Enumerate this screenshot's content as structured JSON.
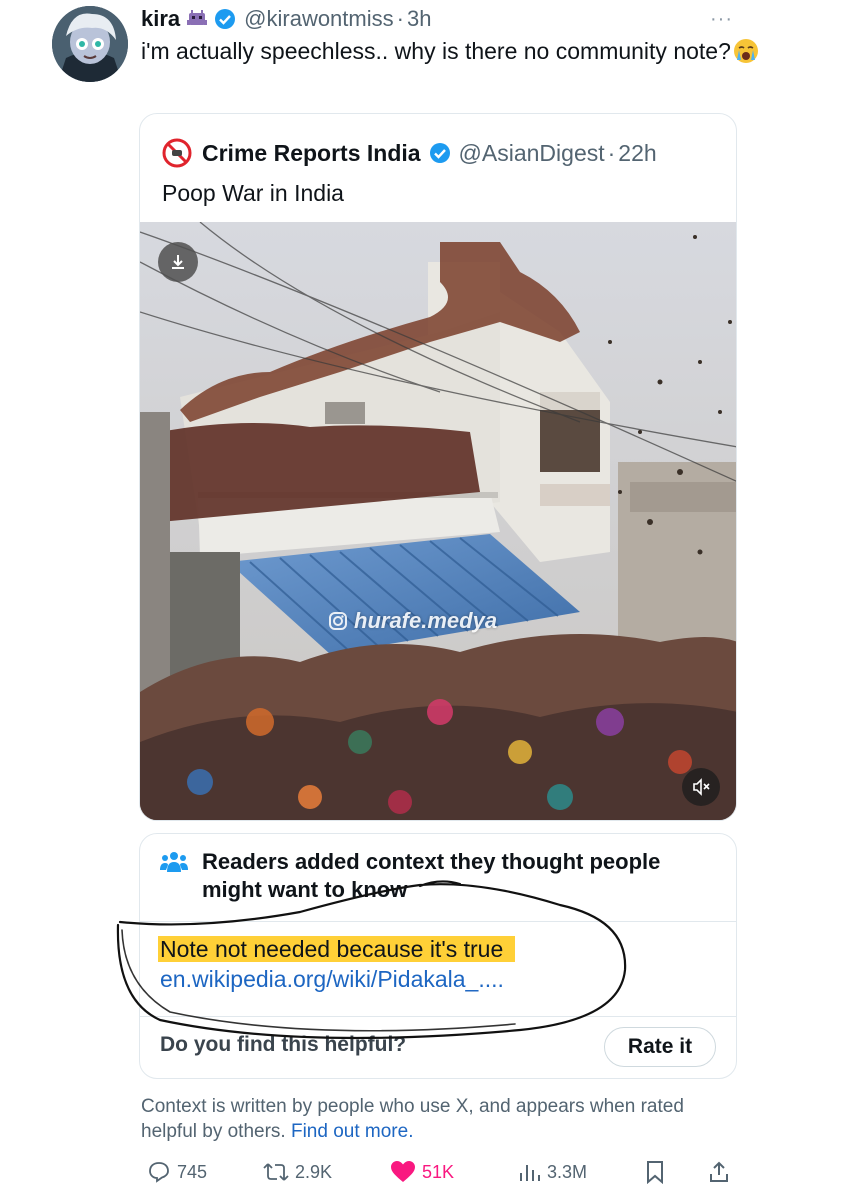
{
  "tweet": {
    "name": "kira",
    "handle": "@kirawontmiss",
    "sep": "·",
    "time": "3h",
    "text": "i'm actually speechless.. why is there no community note?",
    "more": "···"
  },
  "quote": {
    "name": "Crime Reports India",
    "handle": "@AsianDigest",
    "sep": "·",
    "time": "22h",
    "text": "Poop War in India",
    "watermark": "hurafe.medya"
  },
  "note": {
    "title": "Readers added context they thought people might want to know",
    "body": "Note not needed because it's true",
    "link": "en.wikipedia.org/wiki/Pidakala_....",
    "question": "Do you find this helpful?",
    "rate_label": "Rate it"
  },
  "context": {
    "text": "Context is written by people who use X, and appears when rated helpful by others.",
    "link": "Find out more."
  },
  "actions": {
    "replies": "745",
    "reposts": "2.9K",
    "likes": "51K",
    "views": "3.3M"
  },
  "colors": {
    "verified": "#1d9bf0",
    "like": "#f91880",
    "link": "#1d66c2",
    "highlight": "#ffc814"
  },
  "icons": [
    "verified-badge-icon",
    "more-icon",
    "download-icon",
    "mute-icon",
    "instagram-icon",
    "community-notes-icon",
    "reply-icon",
    "repost-icon",
    "heart-icon",
    "views-icon",
    "bookmark-icon",
    "share-icon"
  ]
}
